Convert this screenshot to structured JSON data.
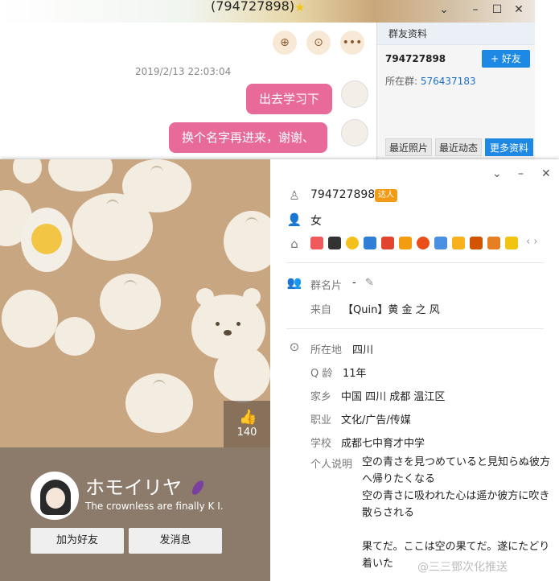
{
  "chat_window": {
    "title": "(794727898)",
    "timestamp": "2019/2/13 22:03:04",
    "messages": [
      "出去学习下",
      "换个名字再进来，谢谢、"
    ],
    "side_panel": {
      "header": "群友资料",
      "qq": "794727898",
      "add_friend": "+ 好友",
      "group_label": "所在群:",
      "group_number": "576437183",
      "tabs": [
        "最近照片",
        "最近动态",
        "更多资料"
      ]
    }
  },
  "profile": {
    "likes": "140",
    "nickname": "ホモイリヤ",
    "signature": "The crownless are finally K I.",
    "add_friend_button": "加为好友",
    "send_message_button": "发消息",
    "qq": "794727898",
    "qq_badge": "达人",
    "gender": "女",
    "group_card_label": "群名片",
    "group_card_value": "-",
    "source_label": "来自",
    "source_value": "【Quin】黄 金 之 风",
    "location_label": "所在地",
    "location_value": "四川",
    "qage_label": "Q 龄",
    "qage_value": "11年",
    "hometown_label": "家乡",
    "hometown_value": "中国 四川 成都 温江区",
    "job_label": "职业",
    "job_value": "文化/广告/传媒",
    "school_label": "学校",
    "school_value": "成都七中育才中学",
    "bio_label": "个人说明",
    "bio_lines": [
      "空の青さを見つめていると見知らぬ彼方へ帰りたくなる",
      "空の青さに吸われた心は遥か彼方に吹き散らされる",
      "",
      "果てだ。ここは空の果てだ。遂にたどり着いた"
    ],
    "watermark": "@三三鄧次化推送"
  },
  "colors": {
    "bubble": "#e86a9b",
    "accent_blue": "#1e88e5",
    "cover_bg": "#c9a682",
    "cover_bottom": "#8c7b6a"
  }
}
